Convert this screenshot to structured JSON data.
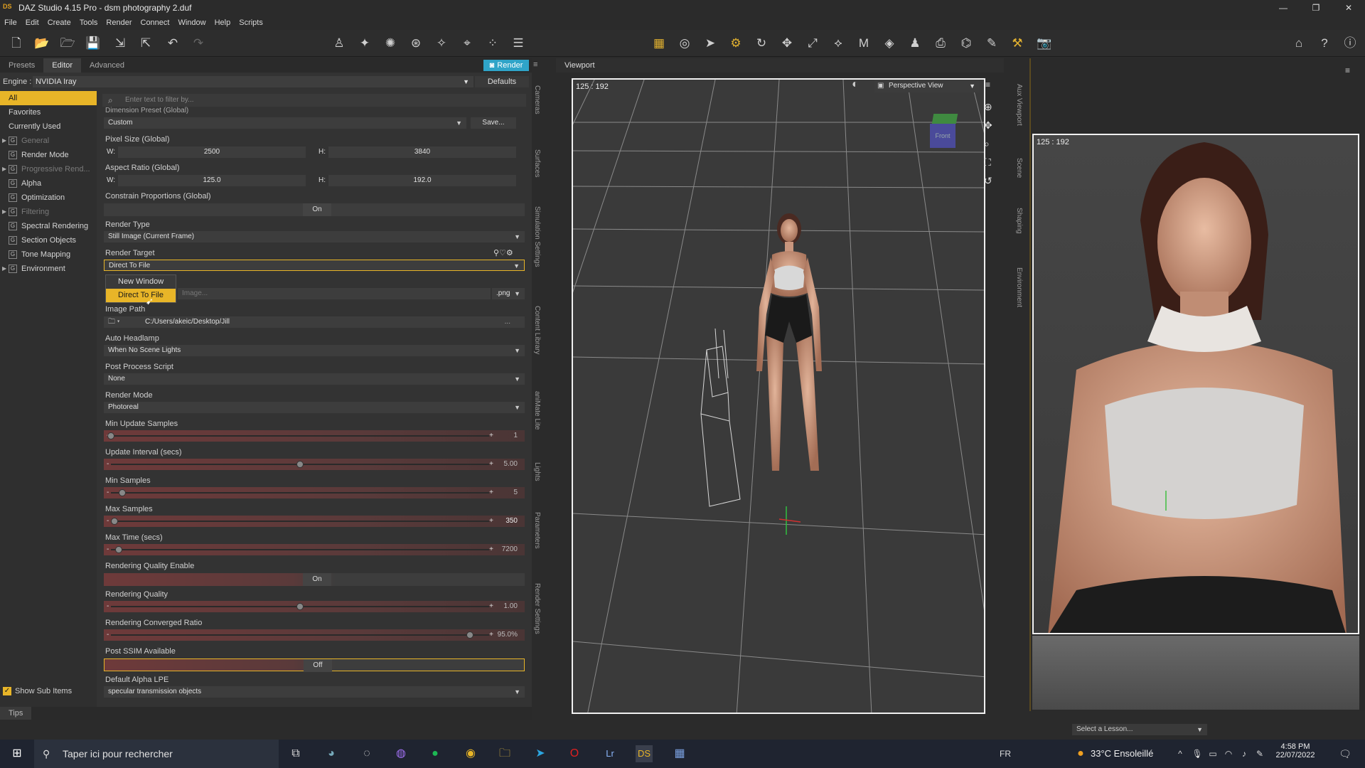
{
  "window": {
    "title": "DAZ Studio 4.15 Pro - dsm photography 2.duf",
    "logo": "DS",
    "controls": [
      "—",
      "❐",
      "✕"
    ]
  },
  "menu": [
    "File",
    "Edit",
    "Create",
    "Tools",
    "Render",
    "Connect",
    "Window",
    "Help",
    "Scripts"
  ],
  "panel": {
    "tabs": [
      "Presets",
      "Editor",
      "Advanced"
    ],
    "render_button": "Render",
    "engine_label": "Engine :",
    "engine_value": "NVIDIA Iray",
    "defaults": "Defaults",
    "filter_placeholder": "Enter text to filter by...",
    "show_sub_items": "Show Sub Items",
    "tips": "Tips"
  },
  "categories": [
    {
      "label": "All",
      "selected": true
    },
    {
      "label": "Favorites"
    },
    {
      "label": "Currently Used"
    },
    {
      "label": "General",
      "dim": true,
      "group": true,
      "expander": true
    },
    {
      "label": "Render Mode",
      "group": true
    },
    {
      "label": "Progressive Rend...",
      "dim": true,
      "group": true,
      "expander": true
    },
    {
      "label": "Alpha",
      "group": true
    },
    {
      "label": "Optimization",
      "group": true
    },
    {
      "label": "Filtering",
      "dim": true,
      "group": true,
      "expander": true
    },
    {
      "label": "Spectral Rendering",
      "group": true
    },
    {
      "label": "Section Objects",
      "group": true
    },
    {
      "label": "Tone Mapping",
      "group": true
    },
    {
      "label": "Environment",
      "group": true,
      "expander": true
    }
  ],
  "props": {
    "dimension_preset_label": "Dimension Preset (Global)",
    "dimension_preset_value": "Custom",
    "dimension_save": "Save...",
    "pixel_size_label": "Pixel Size (Global)",
    "pixel_w": "2500",
    "pixel_h": "3840",
    "aspect_label": "Aspect Ratio (Global)",
    "aspect_w": "125.0",
    "aspect_h": "192.0",
    "w_label": "W:",
    "h_label": "H:",
    "constrain_label": "Constrain Proportions (Global)",
    "constrain_value": "On",
    "render_type_label": "Render Type",
    "render_type_value": "Still Image (Current Frame)",
    "render_target_label": "Render Target",
    "render_target_value": "Direct To File",
    "image_name_placeholder": "Image...",
    "image_ext": ".png",
    "image_path_label": "Image Path",
    "image_path_value": "C:/Users/akeic/Desktop/Jill",
    "image_path_browse": "...",
    "auto_headlamp_label": "Auto Headlamp",
    "auto_headlamp_value": "When No Scene Lights",
    "post_script_label": "Post Process Script",
    "post_script_value": "None",
    "render_mode_label": "Render Mode",
    "render_mode_value": "Photoreal",
    "min_update_label": "Min Update Samples",
    "min_update_value": "1",
    "update_interval_label": "Update Interval (secs)",
    "update_interval_value": "5.00",
    "min_samples_label": "Min Samples",
    "min_samples_value": "5",
    "max_samples_label": "Max Samples",
    "max_samples_value": "350",
    "max_time_label": "Max Time (secs)",
    "max_time_value": "7200",
    "rq_enable_label": "Rendering Quality Enable",
    "rq_enable_value": "On",
    "rq_label": "Rendering Quality",
    "rq_value": "1.00",
    "conv_label": "Rendering Converged Ratio",
    "conv_value": "95.0%",
    "ssim_label": "Post SSIM Available",
    "ssim_value": "Off",
    "alpha_lpe_label": "Default Alpha LPE",
    "alpha_lpe_value": "specular transmission objects"
  },
  "slider_levels": {
    "min_update": 0.0,
    "update_interval": 0.5,
    "min_samples": 0.03,
    "max_samples": 0.01,
    "max_time": 0.02,
    "rq": 0.5,
    "conv": 0.95
  },
  "popup_options": [
    {
      "label": "New Window"
    },
    {
      "label": "Direct To File",
      "selected": true
    }
  ],
  "side_tabs_left": [
    "Cameras",
    "Surfaces",
    "Simulation Settings",
    "Content Library",
    "aniMate Lite",
    "Lights",
    "Parameters",
    "Render Settings"
  ],
  "side_tabs_right": [
    "Aux Viewport",
    "Scene",
    "Shaping",
    "Environment"
  ],
  "viewport": {
    "tab": "Viewport",
    "resolution": "125 : 192",
    "view_mode": "Perspective View",
    "cube_label": "Front"
  },
  "aux": {
    "resolution": "125 : 192",
    "lesson_placeholder": "Select a Lesson..."
  },
  "taskbar": {
    "search": "Taper ici pour rechercher",
    "lang": "FR",
    "weather": "33°C Ensoleillé",
    "time": "4:58 PM",
    "date": "22/07/2022"
  },
  "colors": {
    "accent": "#e8b528",
    "render_button": "#2fa4c8",
    "panel_bg": "#333333"
  }
}
